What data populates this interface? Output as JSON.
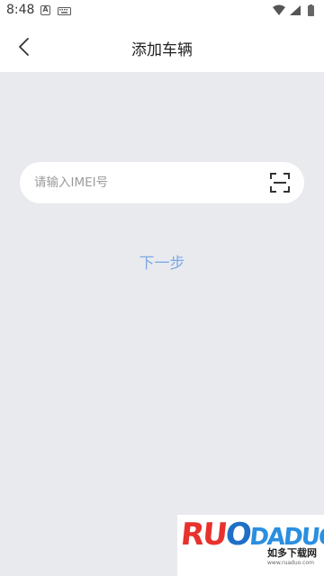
{
  "status_bar": {
    "time": "8:48",
    "left_icons": [
      "android-a-icon",
      "keyboard-icon"
    ],
    "right_icons": [
      "wifi-icon",
      "signal-icon",
      "battery-icon"
    ]
  },
  "header": {
    "title": "添加车辆",
    "back_icon": "chevron-left-icon"
  },
  "imei": {
    "placeholder": "请输入IMEI号",
    "value": "",
    "scan_icon": "scan-icon"
  },
  "actions": {
    "next_label": "下一步"
  },
  "watermark": {
    "logo_text": "RUODADUO",
    "subtitle": "如多下载网",
    "url": "www.ruaduo.com"
  },
  "colors": {
    "background": "#e9eaee",
    "surface": "#ffffff",
    "next_text": "#7fa8e6",
    "logo_red": "#e8312c",
    "logo_blue": "#1f6fc6"
  }
}
